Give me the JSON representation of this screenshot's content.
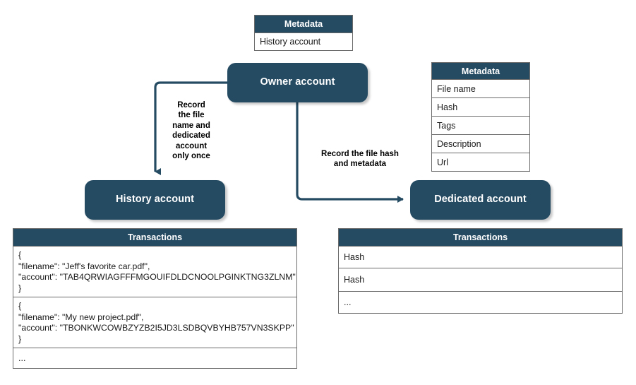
{
  "diagram": {
    "title": "Owner account file recording flow",
    "accent_color": "#254b63",
    "border_color": "#6b6b6b",
    "text_color": "#1a1a1a"
  },
  "nodes": {
    "owner": {
      "label": "Owner account"
    },
    "history": {
      "label": "History account"
    },
    "dedicated": {
      "label": "Dedicated account"
    }
  },
  "edges": {
    "owner_to_history": {
      "label": "Record\nthe file\nname and\ndedicated\naccount\nonly once"
    },
    "owner_to_dedicated": {
      "label": "Record the file hash\nand metadata"
    }
  },
  "history_metadata_table": {
    "header": "Metadata",
    "rows": [
      "History account"
    ]
  },
  "dedicated_metadata_table": {
    "header": "Metadata",
    "rows": [
      "File name",
      "Hash",
      "Tags",
      "Description",
      "Url"
    ]
  },
  "history_transactions_table": {
    "header": "Transactions",
    "rows": [
      "{\n\"filename\": \"Jeff's favorite car.pdf\",\n\"account\": \"TAB4QRWIAGFFFMGOUIFDLDCNOOLPGINKTNG3ZLNM\"\n}",
      "{\n\"filename\": \"My new project.pdf\",\n\"account\": \"TBONKWCOWBZYZB2I5JD3LSDBQVBYHB757VN3SKPP\"\n}",
      "..."
    ]
  },
  "dedicated_transactions_table": {
    "header": "Transactions",
    "rows": [
      "Hash",
      "Hash",
      "..."
    ]
  }
}
